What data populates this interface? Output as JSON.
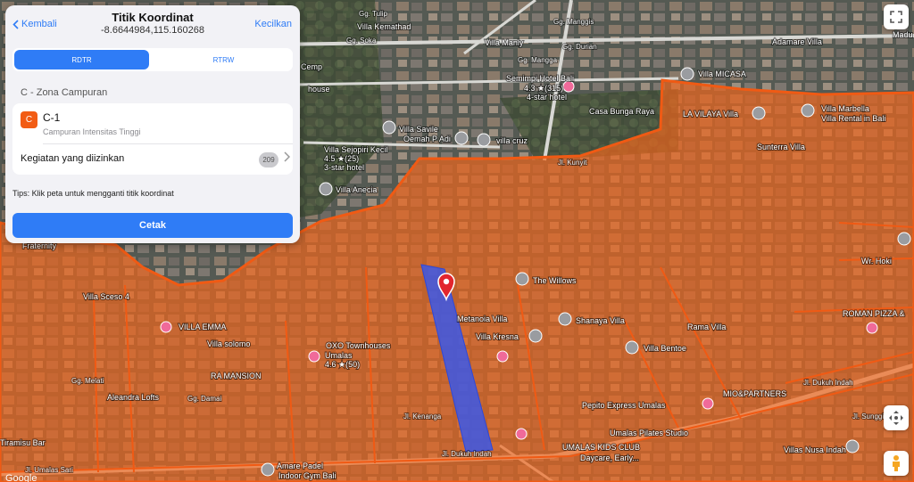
{
  "header": {
    "back_label": "Kembali",
    "title": "Titik Koordinat",
    "coordinates": "-8.6644984,115.160268",
    "cancel_label": "Kecilkan"
  },
  "tabs": [
    {
      "label": "RDTR",
      "active": true
    },
    {
      "label": "RTRW",
      "active": false
    }
  ],
  "zone": {
    "title": "C - Zona Campuran",
    "badge": "C",
    "badge_color": "#f25c14",
    "name": "C-1",
    "description": "Campuran Intensitas Tinggi",
    "activity_label": "Kegiatan yang diizinkan",
    "activity_count": "209"
  },
  "tips": "Tips: Klik peta untuk mengganti titik koordinat",
  "print_label": "Cetak",
  "colors": {
    "accent": "#2f7cf6",
    "zone_overlay": "#f2651c",
    "parcel_highlight": "#3b58e8",
    "pin": "#e2262e"
  },
  "map_labels": {
    "tulip": "Gg. Tulip",
    "villa_kemathad": "Villa Kemathad",
    "manggis": "Gg. Manggis",
    "villa_manly": "Villa Manly",
    "durian": "Gg. Durian",
    "adamare": "Adamare Villa",
    "madu": "Madu",
    "soka": "Gg. Soka",
    "mangga": "Gg. Mangga",
    "villa_micasa": "Villa MICASA",
    "semimpi": "Semimpi Hotel Bali",
    "semimpi_rating": "4.3 ★(315)",
    "semimpi_class": "4-star hotel",
    "cemp": "Cemp",
    "house": "house",
    "casa_bunga": "Casa Bunga Raya",
    "la_vilaya": "LA VILAYA Villa",
    "villa_marbella": "Villa Marbella",
    "villa_rental": "Villa Rental in Bali",
    "villa_savile": "Villa Savile",
    "oemah": "Oemah P Adi",
    "villa_cruz": "villa cruz",
    "kunyit": "Jl. Kunyit",
    "sejopiri": "Villa Sejopiri Kecil",
    "sejopiri_rating": "4.5 ★(25)",
    "sejopiri_class": "3-star hotel",
    "sunterra": "Sunterra Villa",
    "villa_anecia": "Villa Anecia",
    "wr_hoki": "Wr. Hoki",
    "fraternity": "Fraternity",
    "villa_sceso": "Villa Sceso 4",
    "the_willows": "The Willows",
    "metanoia": "Metanoia Villa",
    "shanaya": "Shanaya Villa",
    "roman_pizza": "ROMAN PIZZA &",
    "villa_emma": "VILLA EMMA",
    "villa_solomo": "Villa solomo",
    "oxo": "OXO Townhouses",
    "oxo_sub": "Umalas",
    "oxo_rating": "4.6 ★(50)",
    "villa_kresna": "Villa Kresna",
    "villa_bentoe": "Villa Bentoe",
    "rama_villa": "Rama Villa",
    "ra_mansion": "RA MANSION",
    "aleandra": "Aleandra Lofts",
    "mio_partners": "MIO&PARTNERS",
    "dukuh_indah_e": "Jl. Dukuh Indah",
    "pepito": "Pepito Express Umalas",
    "umalas_pilates": "Umalas Pilates Studio",
    "kids_club": "UMALAS KIDS CLUB",
    "daycare": "Daycare, Early...",
    "villas_nusa": "Villas Nusa Indah",
    "tiramisu": "Tiramisu Bar",
    "umalas_sari": "Jl. Umalas Sari",
    "amare_padel": "Amare Padel",
    "amare_sub": "Indoor Gym Bali",
    "dukuh_indah": "Jl. Dukuh Indah",
    "sunggi": "Jl. Sunggi",
    "kenanga": "Jl. Kenanga",
    "gg_melati": "Gg. Melati",
    "gg_damai": "Gg. Damai",
    "google": "Google"
  }
}
